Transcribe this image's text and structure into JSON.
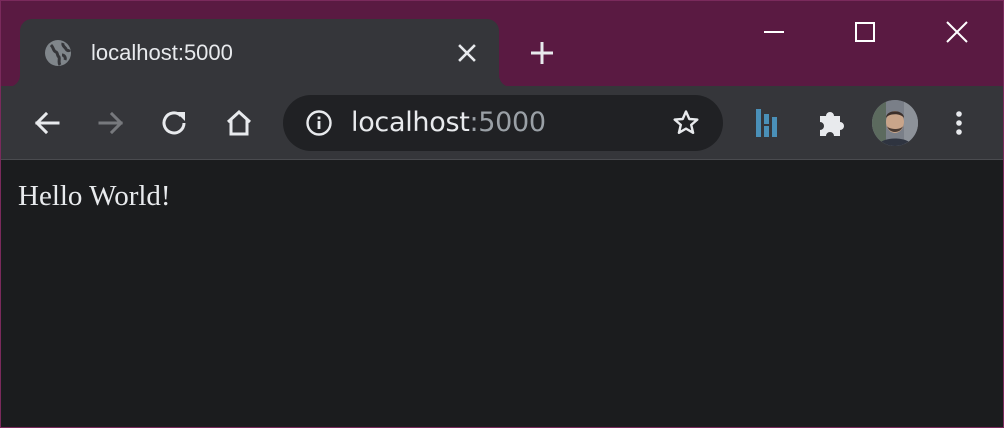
{
  "window": {
    "accent_color": "#5a1a42",
    "controls": {
      "minimize_icon": "minimize-icon",
      "maximize_icon": "maximize-icon",
      "close_icon": "close-icon"
    }
  },
  "tab": {
    "title": "localhost:5000",
    "favicon_icon": "globe-icon",
    "close_icon": "close-icon"
  },
  "new_tab_icon": "plus-icon",
  "toolbar": {
    "back_icon": "arrow-left-icon",
    "forward_icon": "arrow-right-icon",
    "reload_icon": "reload-icon",
    "home_icon": "home-icon"
  },
  "omnibox": {
    "host": "localhost",
    "port": ":5000",
    "info_icon": "info-icon",
    "bookmark_icon": "star-icon"
  },
  "extensions": [
    {
      "icon": "extension-logo-icon"
    },
    {
      "icon": "puzzle-icon"
    }
  ],
  "menu_icon": "more-vert-icon",
  "page": {
    "text": "Hello World!"
  }
}
